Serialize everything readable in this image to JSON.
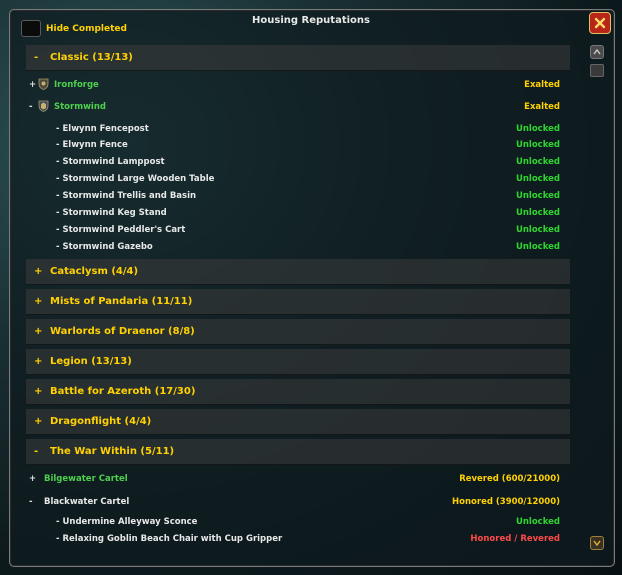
{
  "window": {
    "title": "Housing Reputations",
    "close_icon": "close-x-icon"
  },
  "filter": {
    "hide_completed_label": "Hide Completed",
    "hide_completed_checked": false
  },
  "sections": {
    "classic": {
      "toggle": "-",
      "label": "Classic (13/13)"
    },
    "cataclysm": {
      "toggle": "+",
      "label": "Cataclysm (4/4)"
    },
    "mists": {
      "toggle": "+",
      "label": "Mists of Pandaria (11/11)"
    },
    "warlords": {
      "toggle": "+",
      "label": "Warlords of Draenor (8/8)"
    },
    "legion": {
      "toggle": "+",
      "label": "Legion (13/13)"
    },
    "bfa": {
      "toggle": "+",
      "label": "Battle for Azeroth (17/30)"
    },
    "dragonflight": {
      "toggle": "+",
      "label": "Dragonflight (4/4)"
    },
    "war_within": {
      "toggle": "-",
      "label": "The War Within (5/11)"
    }
  },
  "classic_factions": {
    "ironforge": {
      "toggle": "+",
      "name": "Ironforge",
      "status": "Exalted",
      "crest_icon": "ironforge-crest-icon"
    },
    "stormwind": {
      "toggle": "-",
      "name": "Stormwind",
      "status": "Exalted",
      "crest_icon": "stormwind-crest-icon"
    }
  },
  "stormwind_items": [
    {
      "label": "- Elwynn Fencepost",
      "status": "Unlocked"
    },
    {
      "label": "- Elwynn Fence",
      "status": "Unlocked"
    },
    {
      "label": "- Stormwind Lamppost",
      "status": "Unlocked"
    },
    {
      "label": "- Stormwind Large Wooden Table",
      "status": "Unlocked"
    },
    {
      "label": "- Stormwind Trellis and Basin",
      "status": "Unlocked"
    },
    {
      "label": "- Stormwind Keg Stand",
      "status": "Unlocked"
    },
    {
      "label": "- Stormwind Peddler's Cart",
      "status": "Unlocked"
    },
    {
      "label": "- Stormwind Gazebo",
      "status": "Unlocked"
    }
  ],
  "war_within_factions": {
    "bilgewater": {
      "toggle": "+",
      "name": "Bilgewater Cartel",
      "status": "Revered (600/21000)"
    },
    "blackwater": {
      "toggle": "-",
      "name": "Blackwater Cartel",
      "status": "Honored (3900/12000)"
    }
  },
  "blackwater_items": [
    {
      "label": "- Undermine Alleyway Sconce",
      "status": "Unlocked"
    },
    {
      "label": "- Relaxing Goblin Beach Chair with Cup Gripper",
      "status": "Honored / Revered"
    }
  ],
  "colors": {
    "gold": "#ffd200",
    "unlocked_green": "#2fd62f",
    "faction_green": "#4ed04e",
    "locked_red": "#ff4a4a",
    "close_red": "#b8261a"
  }
}
